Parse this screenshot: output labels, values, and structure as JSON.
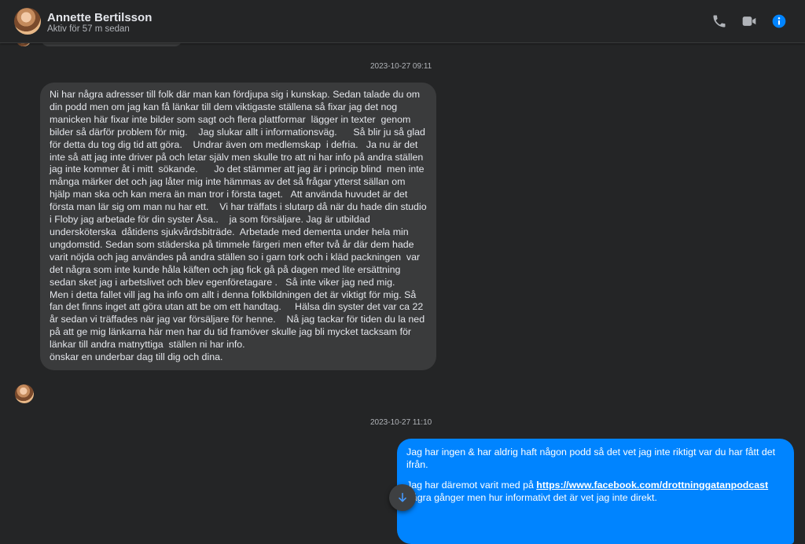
{
  "header": {
    "name": "Annette Bertilsson",
    "status": "Aktiv för 57 m sedan",
    "icons": [
      "phone-icon",
      "video-icon",
      "info-icon"
    ],
    "accent": "#0084ff"
  },
  "messages": [
    {
      "timestamp": "2023-10-27 09:11",
      "direction": "incoming",
      "text": "Ni har några adresser till folk där man kan fördjupa sig i kunskap. Sedan talade du om din podd men om jag kan få länkar till dem viktigaste ställena så fixar jag det nog manicken här fixar inte bilder som sagt och flera plattformar  lägger in texter  genom bilder så därför problem för mig.    Jag slukar allt i informationsväg.      Så blir ju så glad för detta du tog dig tid att göra.    Undrar även om medlemskap  i defria.   Ja nu är det inte så att jag inte driver på och letar själv men skulle tro att ni har info på andra ställen jag inte kommer åt i mitt  sökande.      Jo det stämmer att jag är i princip blind  men inte många märker det och jag låter mig inte hämmas av det så frågar ytterst sällan om hjälp man ska och kan mera än man tror i första taget.   Att använda huvudet är det första man lär sig om man nu har ett.    Vi har träffats i slutarp då när du hade din studio i Floby jag arbetade för din syster Åsa..    ja som försäljare. Jag är utbildad undersköterska  dåtidens sjukvårdsbiträde.  Arbetade med dementa under hela min ungdomstid. Sedan som städerska på timmele färgeri men efter två år där dem hade varit nöjda och jag användes på andra ställen so i garn tork och i kläd packningen  var det några som inte kunde håla käften och jag fick gå på dagen med lite ersättning sedan sket jag i arbetslivet och blev egenföretagare .   Så inte viker jag ned mig.      Men i detta fallet vill jag ha info om allt i denna folkbildningen det är viktigt för mig. Så fan det finns inget att göra utan att be om ett handtag.     Hälsa din syster det var ca 22 år sedan vi träffades när jag var försäljare för henne.    Nå jag tackar för tiden du la ned på att ge mig länkarna här men har du tid framöver skulle jag bli mycket tacksam för länkar till andra matnyttiga  ställen ni har info.\nönskar en underbar dag till dig och dina."
    },
    {
      "timestamp": "2023-10-27 11:10",
      "direction": "outgoing",
      "para1": "Jag har ingen & har aldrig haft någon podd så det vet jag inte riktigt var du har fått det ifrån.",
      "para2_prefix": "Jag har däremot varit med på ",
      "link": "https://www.facebook.com/drottninggatanpodcast",
      "para2_suffix": " några gånger men hur informativt det är vet jag inte direkt."
    }
  ],
  "scroll_button_icon": "arrow-down-icon"
}
